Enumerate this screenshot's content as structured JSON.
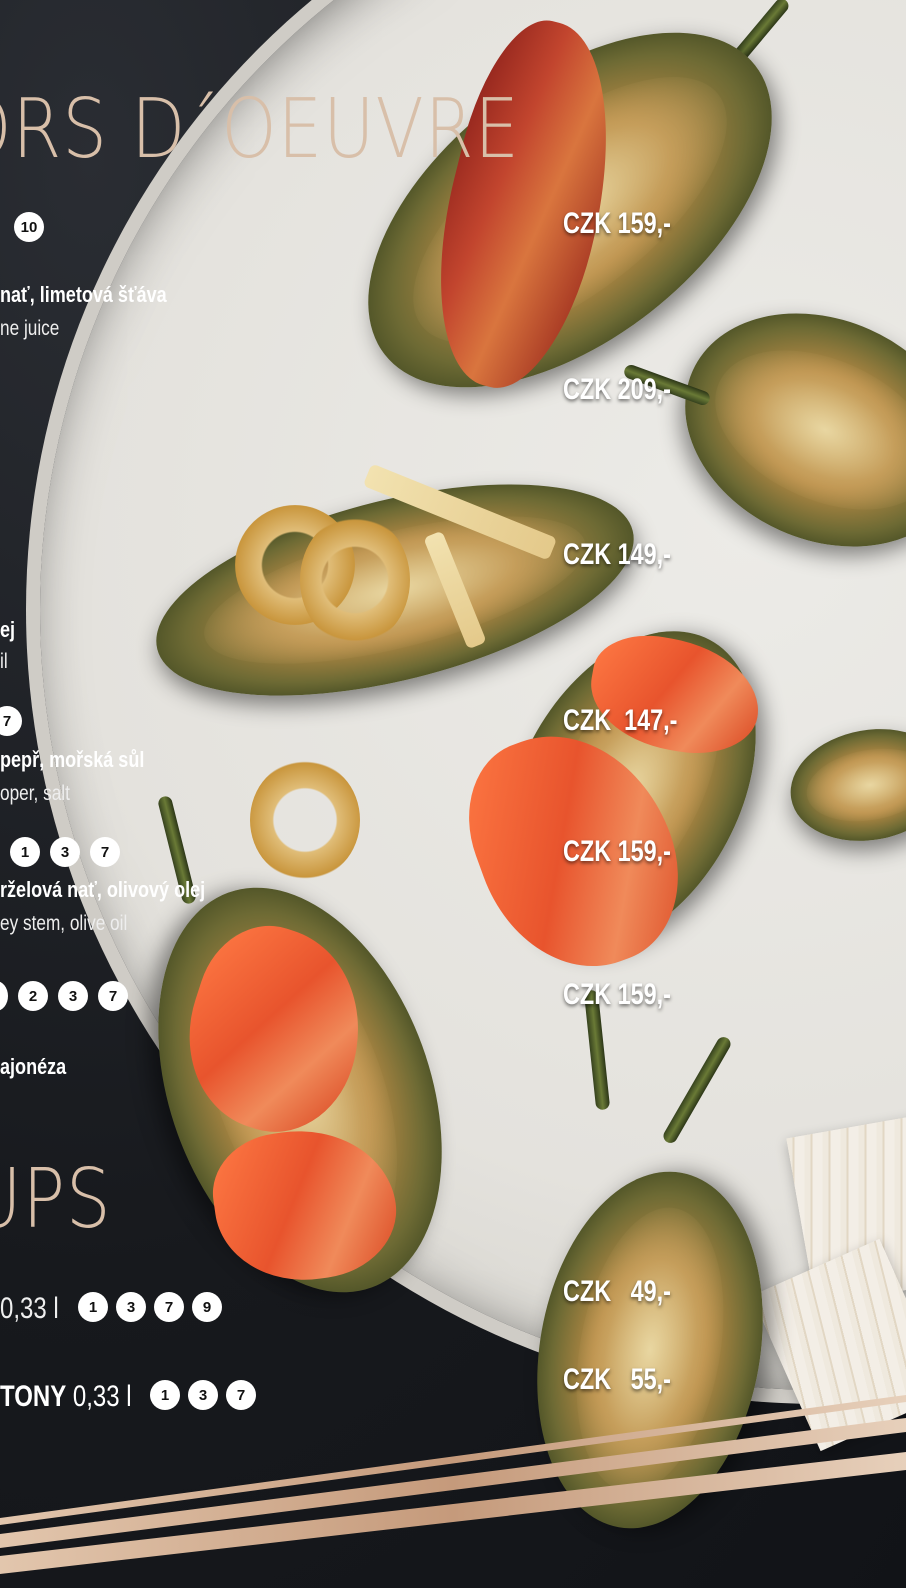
{
  "headings": {
    "hors_doeuvre": "ORS D´OEUVRE",
    "soups": "UPS"
  },
  "items": [
    {
      "allergens": [
        "10"
      ],
      "cz": "nať, limetová šťáva",
      "en": "ne juice",
      "price": "CZK 159,-"
    },
    {
      "price": "CZK 209,-"
    },
    {
      "price": "CZK 149,-"
    },
    {
      "cz": "ej",
      "en": "il"
    },
    {
      "allergens": [
        "7"
      ],
      "cz": "pepř, mořská sůl",
      "en": "oper, salt",
      "price": "CZK  147,-"
    },
    {
      "allergens": [
        "1",
        "3",
        "7"
      ],
      "cz": "rželová nať, olivový olej",
      "en": "ey stem, olive oil",
      "price": "CZK 159,-"
    },
    {
      "allergens": [
        "2",
        "3",
        "7"
      ],
      "cz": "ajonéza",
      "price": "CZK 159,-"
    }
  ],
  "soups": [
    {
      "prefix": "",
      "size": "0,33 l",
      "allergens": [
        "1",
        "3",
        "7",
        "9"
      ],
      "price": "CZK   49,-"
    },
    {
      "prefix": "TONY",
      "size": "0,33 l",
      "allergens": [
        "1",
        "3",
        "7"
      ],
      "price": "CZK   55,-"
    }
  ],
  "colors": {
    "heading": "#d8bfa9",
    "text": "#ffffff",
    "badge_bg": "#ffffff",
    "badge_text": "#111111",
    "stripe": "#d9b59c"
  }
}
